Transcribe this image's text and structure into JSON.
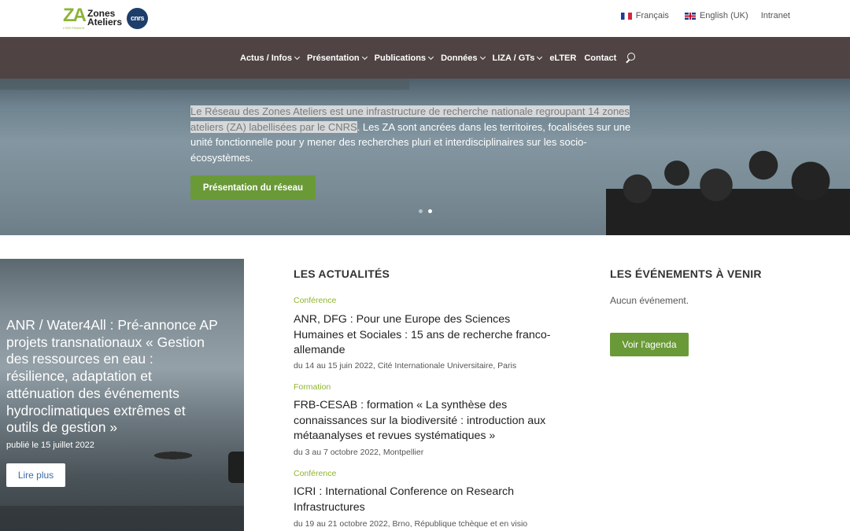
{
  "header": {
    "logo": {
      "mark": "ZA",
      "subtitle": "LTER FRANCE",
      "name_line1": "Zones",
      "name_line2": "Ateliers",
      "partner": "cnrs"
    },
    "languages": [
      {
        "label": "Français",
        "icon": "flag-fr-icon"
      },
      {
        "label": "English (UK)",
        "icon": "flag-uk-icon"
      }
    ],
    "intranet": "Intranet"
  },
  "nav": {
    "items": [
      {
        "label": "Actus / Infos",
        "dropdown": true
      },
      {
        "label": "Présentation",
        "dropdown": true
      },
      {
        "label": "Publications",
        "dropdown": true
      },
      {
        "label": "Données",
        "dropdown": true
      },
      {
        "label": "LIZA / GTs",
        "dropdown": true
      },
      {
        "label": "eLTER",
        "dropdown": false
      },
      {
        "label": "Contact",
        "dropdown": false
      }
    ],
    "search_icon": "search-icon"
  },
  "hero": {
    "highlighted_text": "Le Réseau des Zones Ateliers est une infrastructure de recherche nationale regroupant 14 zones ateliers (ZA) labellisées par le CNRS",
    "text": ". Les ZA sont ancrées dans les territoires, focalisées sur une unité fonctionnelle pour y mener des recherches pluri et interdisciplinaires sur les socio-écosystèmes.",
    "button_label": "Présentation du réseau"
  },
  "feature": {
    "title": "ANR / Water4All : Pré-annonce AP projets transnationaux « Gestion des ressources en eau : résilience, adaptation et atténuation des événements hydroclimatiques extrêmes et outils de gestion »",
    "date": "publié le 15 juillet 2022",
    "button_label": "Lire plus"
  },
  "news": {
    "heading": "LES ACTUALITÉS",
    "items": [
      {
        "category": "Conférence",
        "title": "ANR, DFG : Pour une Europe des Sciences Humaines et Sociales : 15 ans de recherche franco-allemande",
        "meta": "du 14 au 15 juin 2022, Cité Internationale Universitaire, Paris"
      },
      {
        "category": "Formation",
        "title": "FRB-CESAB : formation « La synthèse des connaissances sur la biodiversité : introduction aux métaanalyses et revues systématiques »",
        "meta": "du 3 au 7 octobre 2022, Montpellier"
      },
      {
        "category": "Conférence",
        "title": "ICRI : International Conference on Research Infrastructures",
        "meta": "du 19 au 21 octobre 2022, Brno, République tchèque et en visio"
      }
    ]
  },
  "events": {
    "heading": "LES ÉVÉNEMENTS À VENIR",
    "empty_text": "Aucun événement.",
    "button_label": "Voir l'agenda"
  },
  "colors": {
    "green": "#6a9a38",
    "nav_bg": "#4f4443",
    "category": "#8fb42e"
  }
}
